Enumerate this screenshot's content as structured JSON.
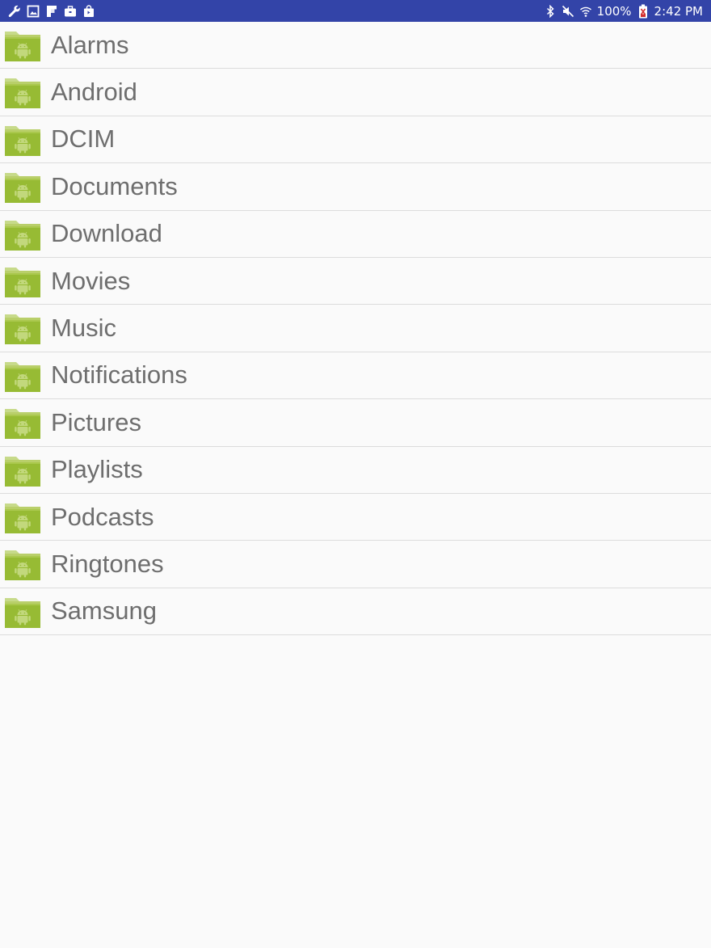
{
  "status_bar": {
    "left_icons": [
      "wrench-icon",
      "image-icon",
      "flipboard-icon",
      "briefcase-icon",
      "shopping-bag-icon"
    ],
    "right_icons": [
      "bluetooth-icon",
      "mute-icon",
      "wifi-icon",
      "battery-icon"
    ],
    "battery": "100%",
    "time": "2:42 PM",
    "background_color": "#3344a8"
  },
  "folders": [
    {
      "name": "Alarms"
    },
    {
      "name": "Android"
    },
    {
      "name": "DCIM"
    },
    {
      "name": "Documents"
    },
    {
      "name": "Download"
    },
    {
      "name": "Movies"
    },
    {
      "name": "Music"
    },
    {
      "name": "Notifications"
    },
    {
      "name": "Pictures"
    },
    {
      "name": "Playlists"
    },
    {
      "name": "Podcasts"
    },
    {
      "name": "Ringtones"
    },
    {
      "name": "Samsung"
    }
  ],
  "colors": {
    "folder_green": "#9bbf3a",
    "text_gray": "#6e6e6e",
    "divider": "#dcdcdc",
    "background": "#fafafa"
  }
}
